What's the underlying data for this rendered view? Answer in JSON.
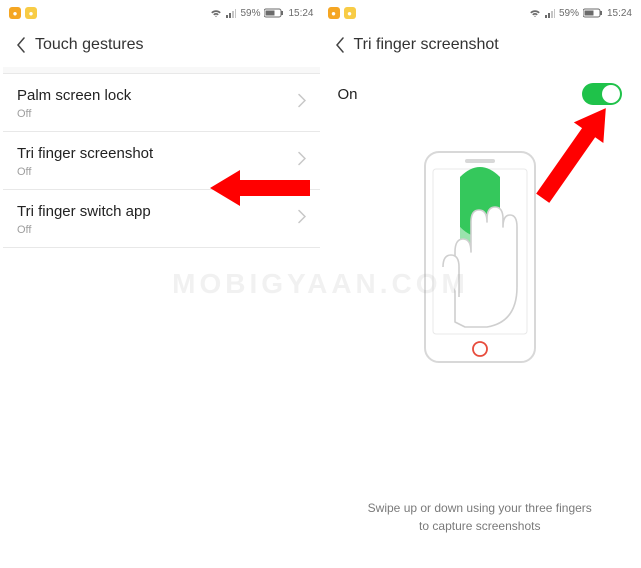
{
  "status": {
    "battery_pct": "59%",
    "time": "15:24"
  },
  "left": {
    "header": {
      "title": "Touch gestures"
    },
    "items": [
      {
        "title": "Palm screen lock",
        "subtitle": "Off"
      },
      {
        "title": "Tri finger screenshot",
        "subtitle": "Off"
      },
      {
        "title": "Tri finger switch app",
        "subtitle": "Off"
      }
    ]
  },
  "right": {
    "header": {
      "title": "Tri finger screenshot"
    },
    "toggle": {
      "label": "On",
      "state": true
    },
    "hint": "Swipe up or down using your three fingers to capture screenshots"
  },
  "watermark": "MOBIGYAAN.COM"
}
